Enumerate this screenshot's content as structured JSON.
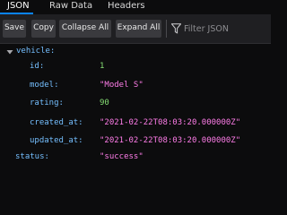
{
  "tabs": [
    "JSON",
    "Raw Data",
    "Headers"
  ],
  "toolbar": {
    "save": "Save",
    "copy": "Copy",
    "collapse_all": "Collapse All",
    "expand_all": "Expand All",
    "filter_placeholder": "Filter JSON",
    "filter_icon": "funnel-icon"
  },
  "tree": {
    "vehicle": {
      "key": "vehicle:",
      "expanded": true,
      "expand_icon": "triangle-down-icon",
      "fields": [
        {
          "key": "id:",
          "value": "1",
          "type": "number"
        },
        {
          "key": "model:",
          "value": "\"Model S\"",
          "type": "string"
        },
        {
          "key": "rating:",
          "value": "90",
          "type": "number"
        },
        {
          "key": "created_at:",
          "value": "\"2021-02-22T08:03:20.000000Z\"",
          "type": "string"
        },
        {
          "key": "updated_at:",
          "value": "\"2021-02-22T08:03:20.000000Z\"",
          "type": "string"
        }
      ]
    },
    "status": {
      "key": "status:",
      "value": "\"success\"",
      "type": "string"
    }
  },
  "colors": {
    "accent": "#0a84ff",
    "key": "#75bfff",
    "number": "#86de74",
    "string": "#ff7de9",
    "background": "#0c0c0d",
    "toolbar": "#1f1f22"
  }
}
